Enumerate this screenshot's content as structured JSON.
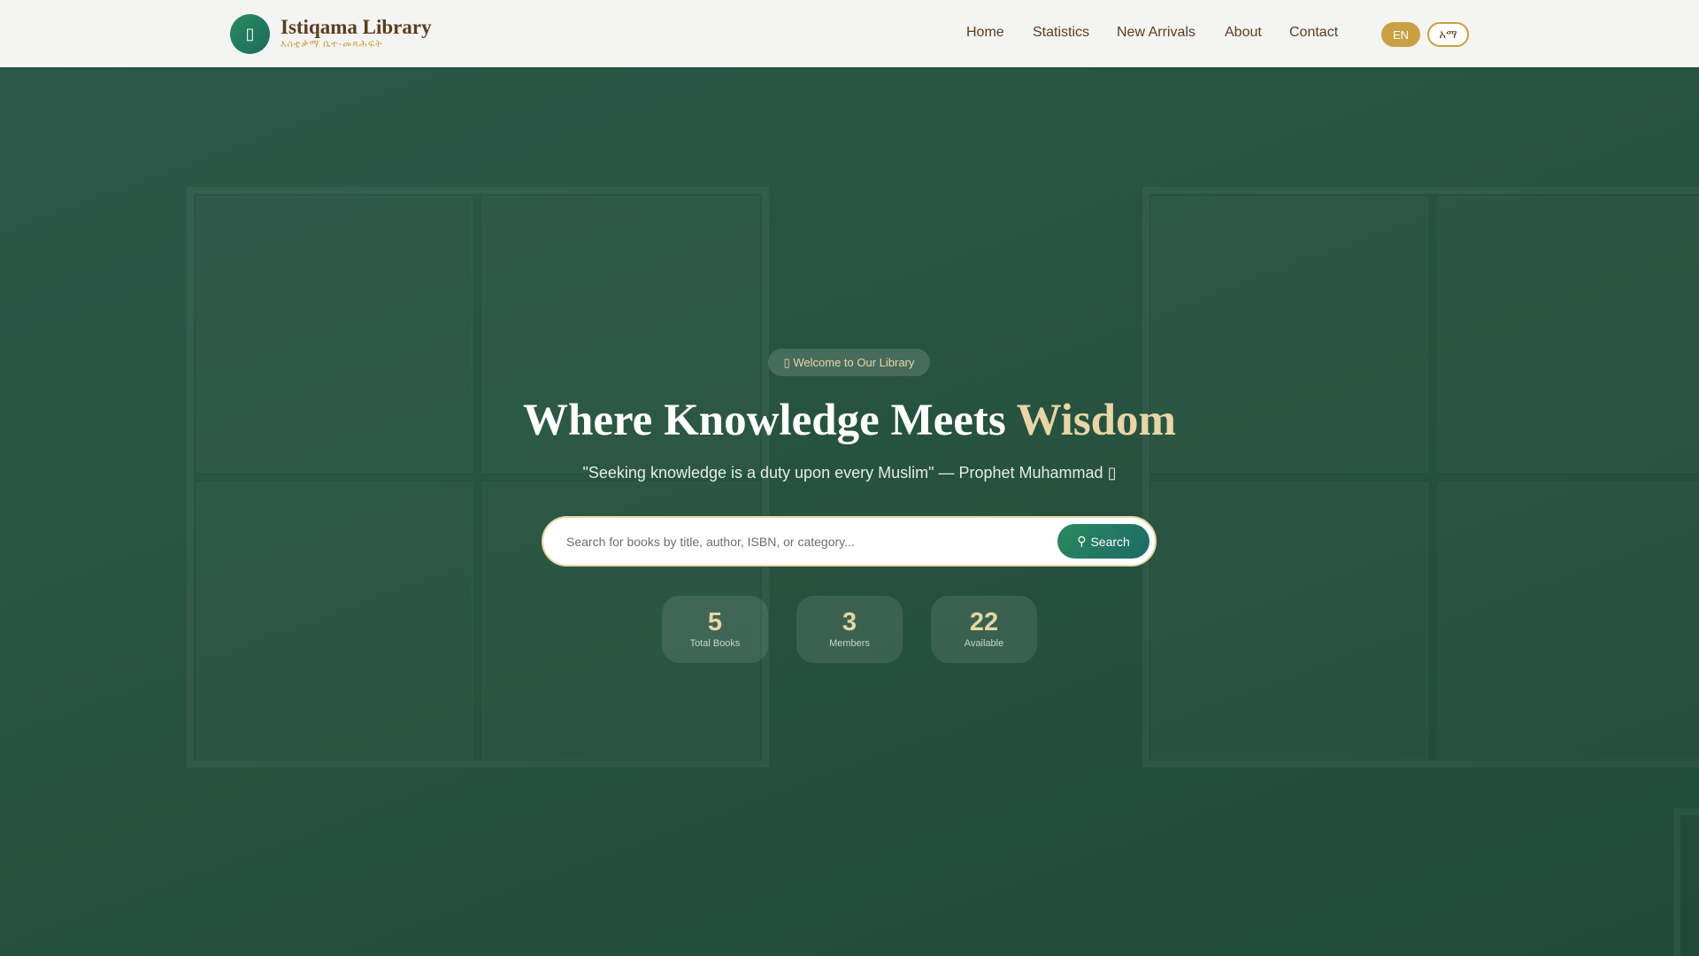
{
  "brand": {
    "title": "Istiqama Library",
    "subtitle": "እስቲቃማ ቤተ-መጻሕፍት",
    "icon": "book-icon"
  },
  "nav": {
    "links": [
      "Home",
      "Statistics",
      "New Arrivals",
      "About",
      "Contact"
    ],
    "lang_en": "EN",
    "lang_am": "አማ"
  },
  "hero": {
    "badge": "Welcome to Our Library",
    "title_main": "Where Knowledge Meets",
    "title_accent": "Wisdom",
    "quote": "\"Seeking knowledge is a duty upon every Muslim\" — Prophet Muhammad",
    "search_placeholder": "Search for books by title, author, ISBN, or category...",
    "search_button": "Search",
    "stats": [
      {
        "value": "5",
        "label": "Total Books"
      },
      {
        "value": "3",
        "label": "Members"
      },
      {
        "value": "22",
        "label": "Available"
      }
    ]
  },
  "colors": {
    "primary": "#27533f",
    "accent": "#e8d6a6",
    "gold": "#c9a043",
    "brown": "#5a3d1e"
  }
}
